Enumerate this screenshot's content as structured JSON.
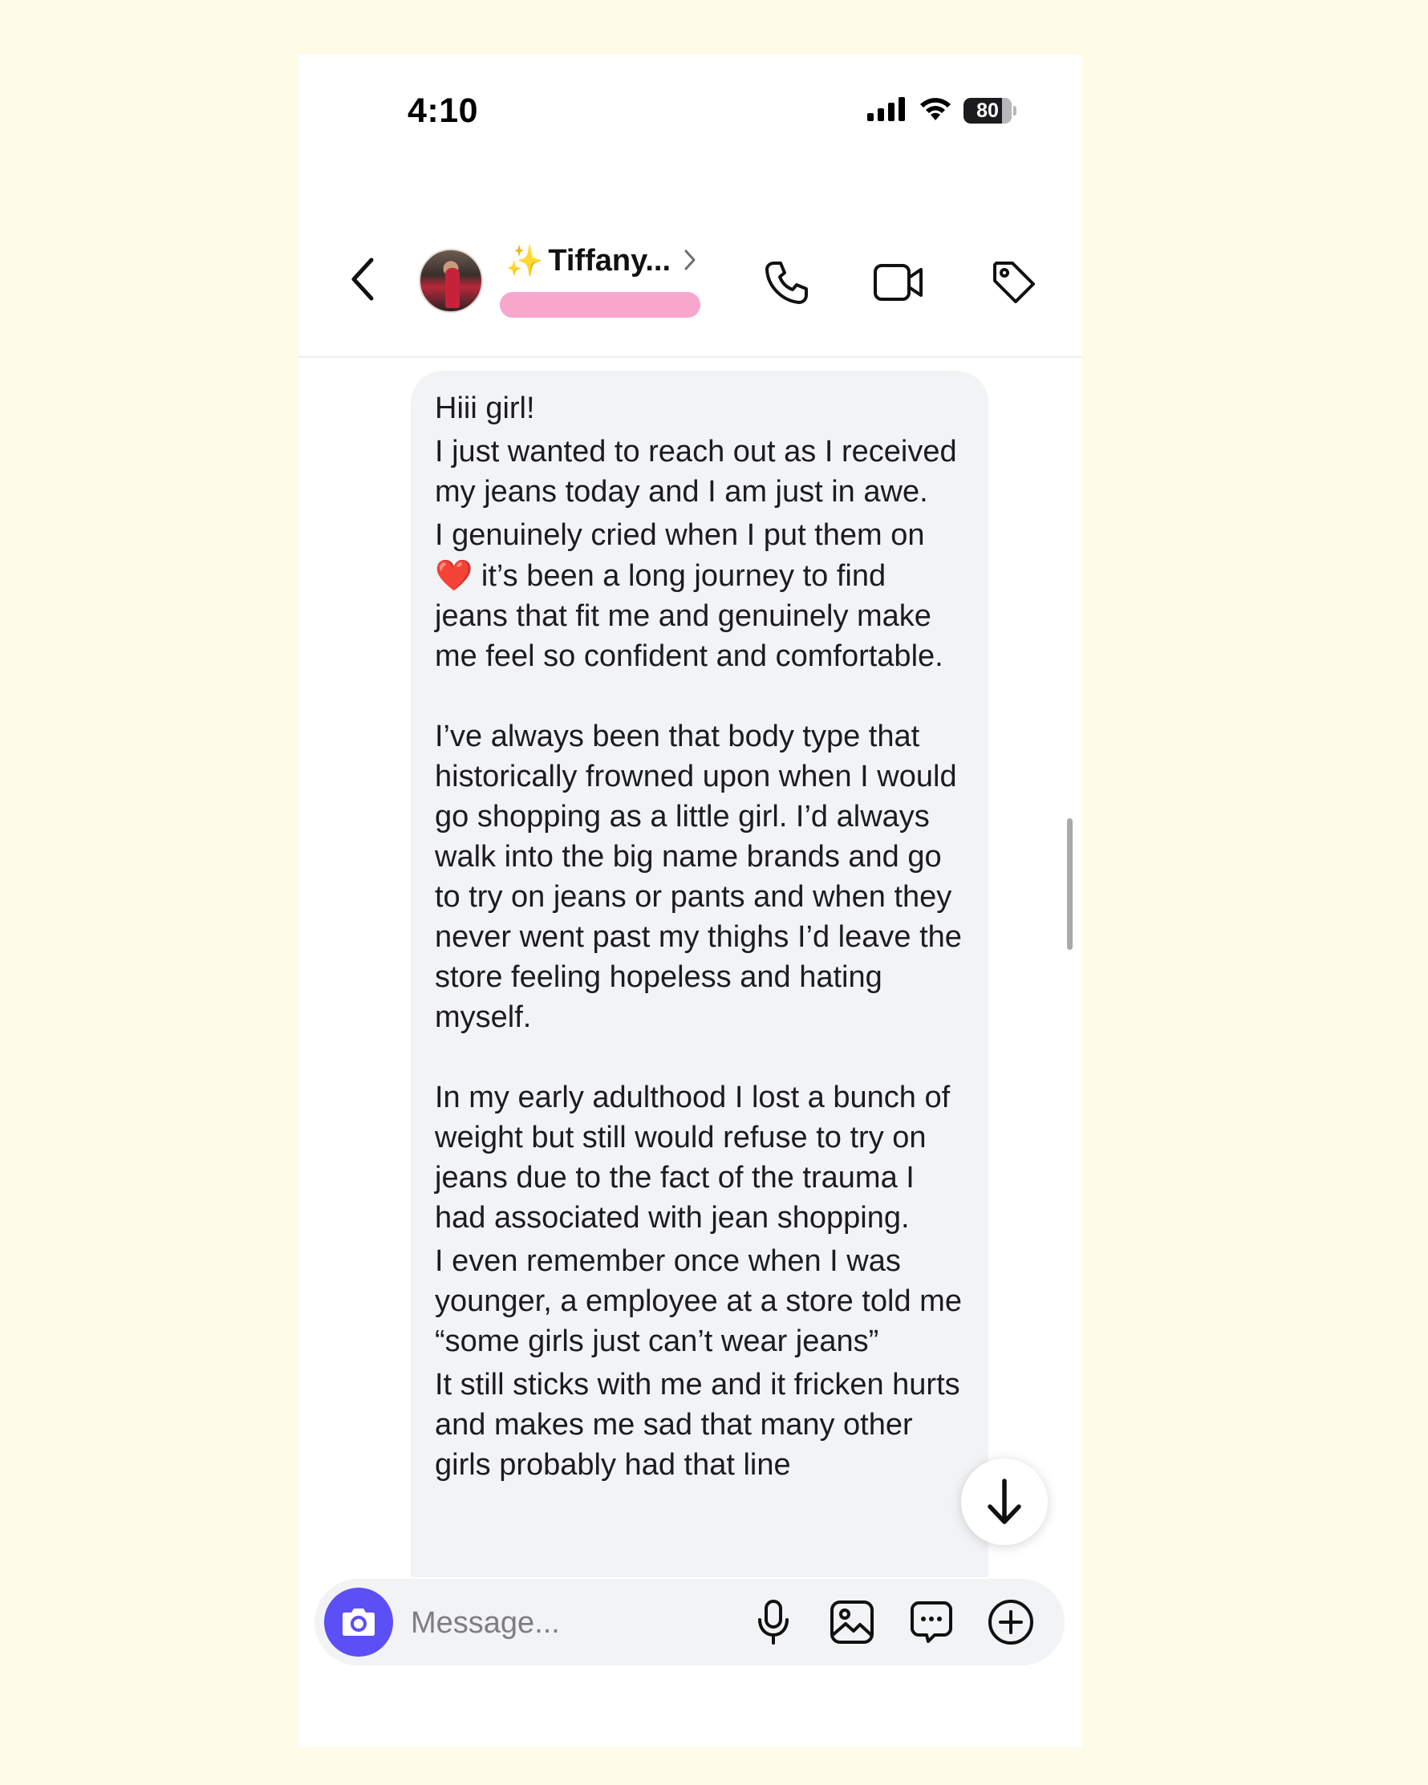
{
  "status_bar": {
    "time": "4:10",
    "battery": "80"
  },
  "header": {
    "sparkle_glyph": "✨",
    "contact_name": "Tiffany...",
    "icons": [
      "back-icon",
      "phone-icon",
      "video-camera-icon",
      "tag-icon"
    ]
  },
  "message": {
    "paragraphs": [
      {
        "text": "Hiii girl!",
        "gap_before": false
      },
      {
        "text": "I just wanted to reach out as I received my jeans today and I am just in awe.",
        "gap_before": false
      },
      {
        "text_before_heart": "I genuinely cried when I put them on ",
        "heart": "❤️",
        "text_after_heart": " it’s been a long journey to find jeans that fit me and genuinely make me feel so confident and comfortable.",
        "gap_before": false
      },
      {
        "text": "I’ve always been that body type that historically frowned upon when I would go shopping as a little girl. I’d always walk into the big name brands and go to try on jeans or pants and when they never went past my thighs I’d leave the store feeling hopeless and hating myself.",
        "gap_before": true
      },
      {
        "text": "In my early adulthood I lost a bunch of weight but still would refuse to try on jeans due to the fact of the trauma I had associated with jean shopping.",
        "gap_before": true
      },
      {
        "text": "I even remember once when I was younger, a employee at a store told me “some girls just can’t wear jeans”",
        "gap_before": false
      },
      {
        "text": "It still sticks with me and it fricken hurts and makes me sad that many other girls probably had that line",
        "gap_before": false
      }
    ]
  },
  "composer": {
    "placeholder": "Message...",
    "value": "",
    "icons": [
      "camera-icon",
      "microphone-icon",
      "image-icon",
      "sticker-chat-icon",
      "plus-circle-icon"
    ]
  },
  "colors": {
    "page_background": "#fefbe6",
    "bubble_background": "#f2f3f5",
    "camera_button": "#5c4ff5",
    "subtitle_pill": "#f7a6cc"
  }
}
